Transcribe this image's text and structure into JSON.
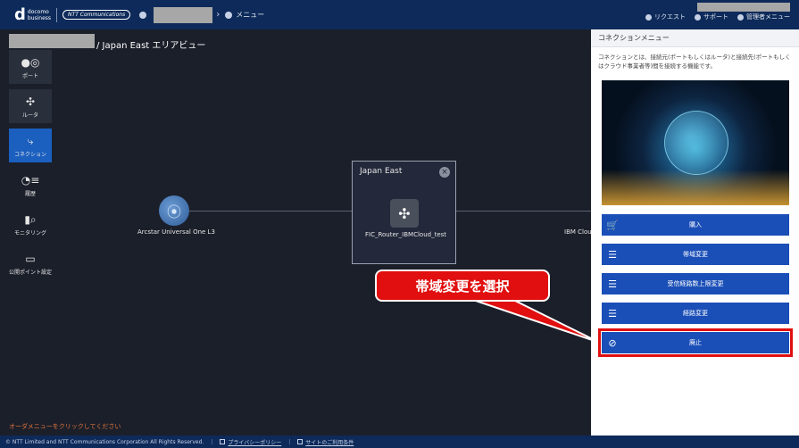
{
  "header": {
    "logo_d": "d",
    "logo_line1": "docomo",
    "logo_line2": "business",
    "ntt_logo": "NTT Communications",
    "breadcrumb_menu": "メニュー",
    "request": "リクエスト",
    "support": "サポート",
    "admin_menu": "管理者メニュー"
  },
  "page": {
    "title": "/ Japan East エリアビュー"
  },
  "sidebar": {
    "items": [
      {
        "label": "ポート",
        "icon": "port-icon"
      },
      {
        "label": "ルータ",
        "icon": "router-icon"
      },
      {
        "label": "コネクション",
        "icon": "connection-icon"
      },
      {
        "label": "履歴",
        "icon": "history-icon"
      },
      {
        "label": "モニタリング",
        "icon": "monitoring-icon"
      },
      {
        "label": "公開ポイント設定",
        "icon": "public-point-icon"
      }
    ]
  },
  "topology": {
    "arcstar_label": "Arcstar Universal One L3",
    "area_title": "Japan East",
    "router_label": "FIC_Router_IBMCloud_test",
    "ibm_label": "IBM Clou"
  },
  "callout": {
    "text": "帯域変更を選択"
  },
  "hint": "オーダメニューをクリックしてください",
  "footer": {
    "copyright": "© NTT Limited and NTT Communications Corporation All Rights Reserved.",
    "privacy": "プライバシーポリシー",
    "terms": "サイトのご利用条件"
  },
  "panel": {
    "title": "コネクションメニュー",
    "description": "コネクションとは、接続元(ポートもしくはルータ)と接続先(ポートもしくはクラウド事業者等)間を接続する機能です。",
    "buttons": [
      {
        "label": "購入",
        "icon": "cart-icon"
      },
      {
        "label": "帯域変更",
        "icon": "sliders-icon"
      },
      {
        "label": "受信経路数上限変更",
        "icon": "sliders-icon"
      },
      {
        "label": "経路変更",
        "icon": "sliders-icon"
      },
      {
        "label": "廃止",
        "icon": "prohibit-icon"
      }
    ]
  },
  "colors": {
    "topbar": "#0d2a5a",
    "accent": "#1b4fb8",
    "callout": "#e10f0f"
  }
}
